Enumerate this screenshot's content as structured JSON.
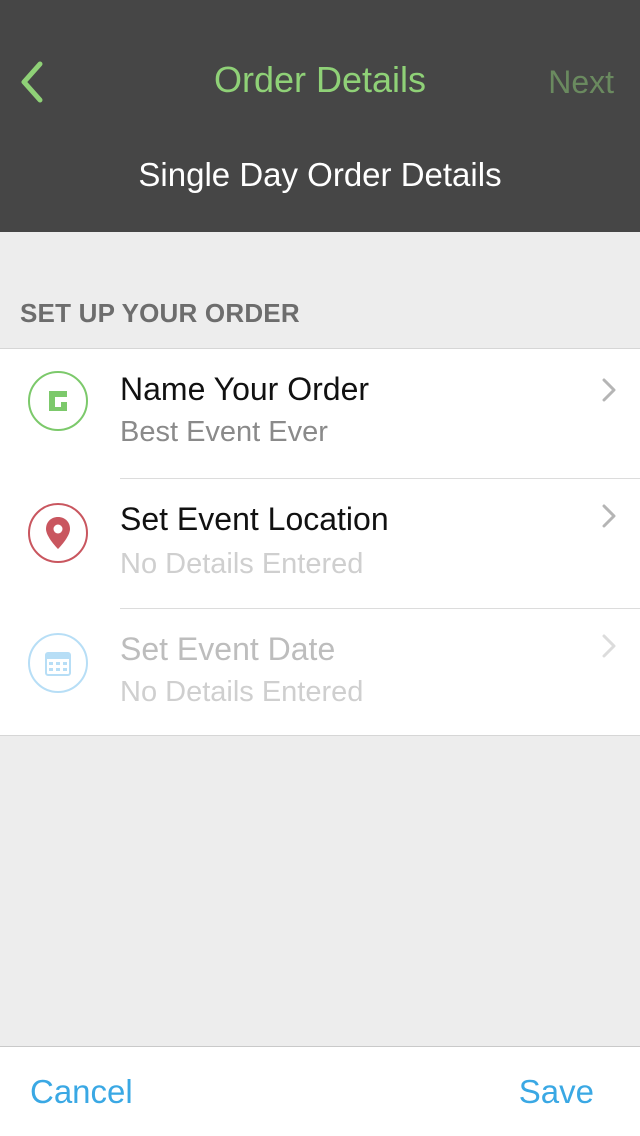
{
  "header": {
    "title": "Order Details",
    "next_label": "Next",
    "subtitle": "Single Day Order Details"
  },
  "section": {
    "title": "SET UP YOUR ORDER"
  },
  "rows": [
    {
      "title": "Name Your Order",
      "value": "Best Event Ever",
      "icon": "order-name-icon",
      "color": "#7cc96b",
      "state": "filled"
    },
    {
      "title": "Set Event Location",
      "value": "No Details Entered",
      "icon": "location-pin-icon",
      "color": "#c9565f",
      "state": "placeholder"
    },
    {
      "title": "Set Event Date",
      "value": "No Details Entered",
      "icon": "calendar-icon",
      "color": "#b7def6",
      "state": "disabled"
    }
  ],
  "footer": {
    "cancel_label": "Cancel",
    "save_label": "Save"
  },
  "colors": {
    "header_bg": "#464646",
    "accent_green": "#8fd177",
    "action_blue": "#3aa8e4"
  }
}
